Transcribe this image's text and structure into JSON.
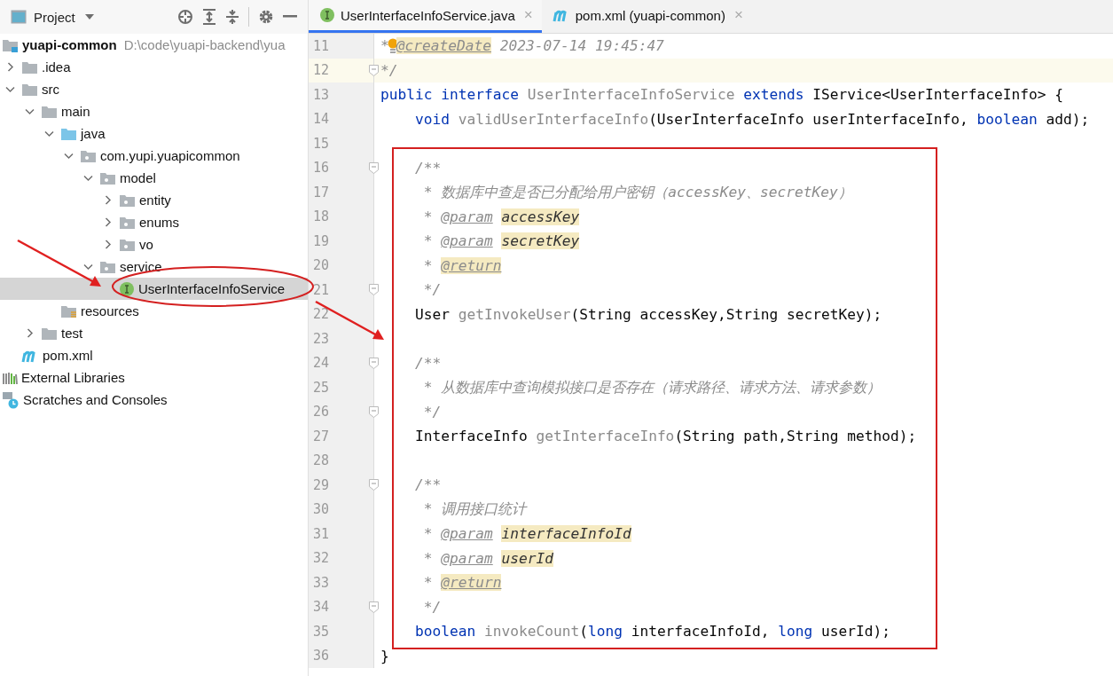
{
  "project_panel": {
    "title": "Project",
    "tree": [
      {
        "label": "yuapi-common",
        "path": "D:\\code\\yuapi-backend\\yua",
        "kind": "module",
        "selected": false,
        "children": [
          {
            "label": ".idea",
            "kind": "folder",
            "expanded": false,
            "selected": false
          },
          {
            "label": "src",
            "kind": "folder",
            "expanded": true,
            "selected": false,
            "children": [
              {
                "label": "main",
                "kind": "folder",
                "expanded": true,
                "selected": false,
                "children": [
                  {
                    "label": "java",
                    "kind": "source-folder",
                    "expanded": true,
                    "selected": false,
                    "children": [
                      {
                        "label": "com.yupi.yuapicommon",
                        "kind": "package",
                        "expanded": true,
                        "selected": false,
                        "children": [
                          {
                            "label": "model",
                            "kind": "package",
                            "expanded": true,
                            "selected": false,
                            "children": [
                              {
                                "label": "entity",
                                "kind": "package",
                                "expanded": false,
                                "selected": false
                              },
                              {
                                "label": "enums",
                                "kind": "package",
                                "expanded": false,
                                "selected": false
                              },
                              {
                                "label": "vo",
                                "kind": "package",
                                "expanded": false,
                                "selected": false
                              }
                            ]
                          },
                          {
                            "label": "service",
                            "kind": "package",
                            "expanded": true,
                            "selected": false,
                            "children": [
                              {
                                "label": "UserInterfaceInfoService",
                                "kind": "interface",
                                "selected": true
                              }
                            ]
                          }
                        ]
                      }
                    ]
                  },
                  {
                    "label": "resources",
                    "kind": "resources-folder",
                    "selected": false
                  }
                ]
              },
              {
                "label": "test",
                "kind": "folder",
                "expanded": false,
                "selected": false
              }
            ]
          },
          {
            "label": "pom.xml",
            "kind": "maven",
            "selected": false
          }
        ]
      },
      {
        "label": "External Libraries",
        "kind": "libraries",
        "selected": false
      },
      {
        "label": "Scratches and Consoles",
        "kind": "scratches",
        "selected": false
      }
    ]
  },
  "tabs": [
    {
      "label": "UserInterfaceInfoService.java",
      "kind": "interface",
      "selected": true,
      "close": "×"
    },
    {
      "label": "pom.xml (yuapi-common)",
      "kind": "maven",
      "selected": false,
      "close": "×"
    }
  ],
  "editor": {
    "lines": [
      {
        "number": "11",
        "current": false,
        "fold": false,
        "tokens": [
          {
            "kind": "comment",
            "text": "*"
          },
          {
            "kind": "bulb"
          },
          {
            "kind": "tag_marked",
            "text": "@createDate"
          },
          {
            "kind": "comment",
            "text": " 2023-07-14 19:45:47"
          }
        ]
      },
      {
        "number": "12",
        "current": true,
        "fold": true,
        "tokens": [
          {
            "kind": "comment",
            "text": "*/"
          }
        ]
      },
      {
        "number": "13",
        "current": false,
        "fold": false,
        "tokens": [
          {
            "kind": "kw",
            "text": "public "
          },
          {
            "kind": "kw",
            "text": "interface "
          },
          {
            "kind": "method",
            "text": "UserInterfaceInfoService "
          },
          {
            "kind": "kw",
            "text": "extends "
          },
          {
            "kind": "plain",
            "text": "IService<UserInterfaceInfo> {"
          }
        ]
      },
      {
        "number": "14",
        "current": false,
        "fold": false,
        "tokens": [
          {
            "kind": "kw",
            "text": "    void "
          },
          {
            "kind": "method",
            "text": "validUserInterfaceInfo"
          },
          {
            "kind": "plain",
            "text": "(UserInterfaceInfo userInterfaceInfo, "
          },
          {
            "kind": "kw",
            "text": "boolean "
          },
          {
            "kind": "plain",
            "text": "add);"
          }
        ]
      },
      {
        "number": "15",
        "current": false,
        "fold": false
      },
      {
        "number": "16",
        "current": false,
        "fold": true,
        "tokens": [
          {
            "kind": "comment",
            "text": "    /**"
          }
        ]
      },
      {
        "number": "17",
        "current": false,
        "fold": false,
        "tokens": [
          {
            "kind": "comment",
            "text": "     * 数据库中查是否已分配给用户密钥（accessKey、secretKey）"
          }
        ]
      },
      {
        "number": "18",
        "current": false,
        "fold": false,
        "tokens": [
          {
            "kind": "comment",
            "text": "     * "
          },
          {
            "kind": "tag",
            "text": "@param"
          },
          {
            "kind": "ref",
            "text": "accessKey"
          }
        ]
      },
      {
        "number": "19",
        "current": false,
        "fold": false,
        "tokens": [
          {
            "kind": "comment",
            "text": "     * "
          },
          {
            "kind": "tag",
            "text": "@param"
          },
          {
            "kind": "ref",
            "text": "secretKey"
          }
        ]
      },
      {
        "number": "20",
        "current": false,
        "fold": false,
        "tokens": [
          {
            "kind": "comment",
            "text": "     * "
          },
          {
            "kind": "tag_marked",
            "text": "@return"
          }
        ]
      },
      {
        "number": "21",
        "current": false,
        "fold": true,
        "tokens": [
          {
            "kind": "comment",
            "text": "     */"
          }
        ]
      },
      {
        "number": "22",
        "current": false,
        "fold": false,
        "tokens": [
          {
            "kind": "plain",
            "text": "    User "
          },
          {
            "kind": "method",
            "text": "getInvokeUser"
          },
          {
            "kind": "plain",
            "text": "(String accessKey,String secretKey);"
          }
        ]
      },
      {
        "number": "23",
        "current": false,
        "fold": false
      },
      {
        "number": "24",
        "current": false,
        "fold": true,
        "tokens": [
          {
            "kind": "comment",
            "text": "    /**"
          }
        ]
      },
      {
        "number": "25",
        "current": false,
        "fold": false,
        "tokens": [
          {
            "kind": "comment",
            "text": "     * 从数据库中查询模拟接口是否存在（请求路径、请求方法、请求参数）"
          }
        ]
      },
      {
        "number": "26",
        "current": false,
        "fold": true,
        "tokens": [
          {
            "kind": "comment",
            "text": "     */"
          }
        ]
      },
      {
        "number": "27",
        "current": false,
        "fold": false,
        "tokens": [
          {
            "kind": "plain",
            "text": "    InterfaceInfo "
          },
          {
            "kind": "method",
            "text": "getInterfaceInfo"
          },
          {
            "kind": "plain",
            "text": "(String path,String method);"
          }
        ]
      },
      {
        "number": "28",
        "current": false,
        "fold": false
      },
      {
        "number": "29",
        "current": false,
        "fold": true,
        "tokens": [
          {
            "kind": "comment",
            "text": "    /**"
          }
        ]
      },
      {
        "number": "30",
        "current": false,
        "fold": false,
        "tokens": [
          {
            "kind": "comment",
            "text": "     * 调用接口统计"
          }
        ]
      },
      {
        "number": "31",
        "current": false,
        "fold": false,
        "tokens": [
          {
            "kind": "comment",
            "text": "     * "
          },
          {
            "kind": "tag",
            "text": "@param"
          },
          {
            "kind": "ref",
            "text": "interfaceInfoId"
          }
        ]
      },
      {
        "number": "32",
        "current": false,
        "fold": false,
        "tokens": [
          {
            "kind": "comment",
            "text": "     * "
          },
          {
            "kind": "tag",
            "text": "@param"
          },
          {
            "kind": "ref",
            "text": "userId"
          }
        ]
      },
      {
        "number": "33",
        "current": false,
        "fold": false,
        "tokens": [
          {
            "kind": "comment",
            "text": "     * "
          },
          {
            "kind": "tag_marked",
            "text": "@return"
          }
        ]
      },
      {
        "number": "34",
        "current": false,
        "fold": true,
        "tokens": [
          {
            "kind": "comment",
            "text": "     */"
          }
        ]
      },
      {
        "number": "35",
        "current": false,
        "fold": false,
        "tokens": [
          {
            "kind": "kw",
            "text": "    boolean "
          },
          {
            "kind": "method",
            "text": "invokeCount"
          },
          {
            "kind": "plain",
            "text": "("
          },
          {
            "kind": "kw",
            "text": "long "
          },
          {
            "kind": "plain",
            "text": "interfaceInfoId, "
          },
          {
            "kind": "kw",
            "text": "long "
          },
          {
            "kind": "plain",
            "text": "userId);"
          }
        ]
      },
      {
        "number": "36",
        "current": false,
        "fold": false,
        "tokens": [
          {
            "kind": "plain",
            "text": "}"
          }
        ]
      }
    ]
  }
}
